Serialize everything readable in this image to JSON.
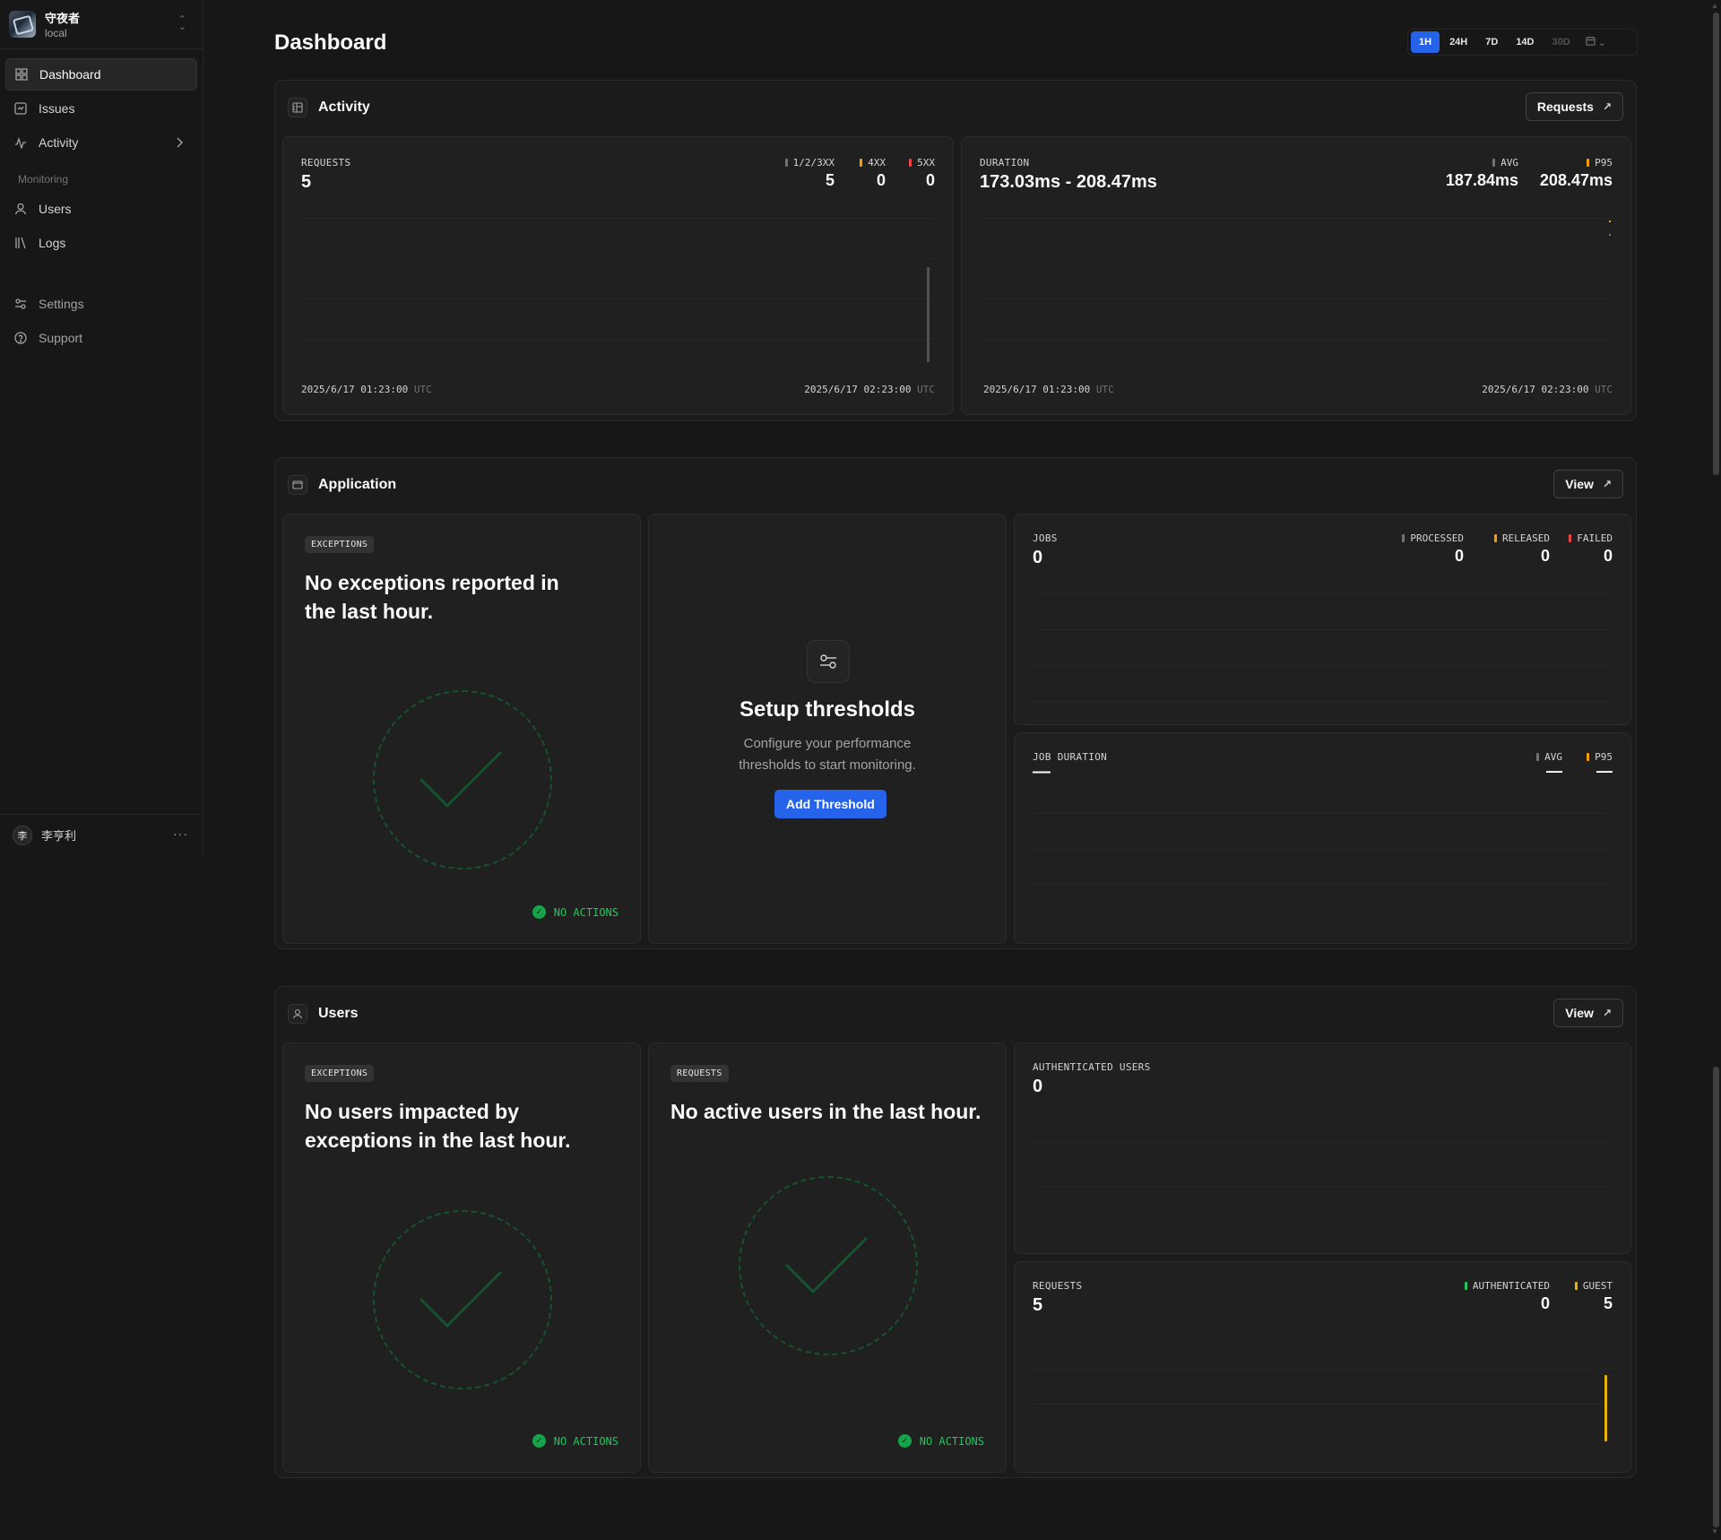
{
  "org": {
    "name": "守夜者",
    "env": "local"
  },
  "nav": {
    "items": [
      {
        "label": "Dashboard",
        "icon": "grid-icon"
      },
      {
        "label": "Issues",
        "icon": "issue-icon"
      },
      {
        "label": "Activity",
        "icon": "pulse-icon"
      }
    ],
    "monitoring_label": "Monitoring",
    "monitoring_items": [
      {
        "label": "Users",
        "icon": "user-icon"
      },
      {
        "label": "Logs",
        "icon": "logs-icon"
      }
    ],
    "footer_items": [
      {
        "label": "Settings",
        "icon": "sliders-icon"
      },
      {
        "label": "Support",
        "icon": "help-icon"
      }
    ]
  },
  "user": {
    "initial": "李",
    "name": "李亨利"
  },
  "page": {
    "title": "Dashboard"
  },
  "range": {
    "options": [
      "1H",
      "24H",
      "7D",
      "14D",
      "30D"
    ],
    "selected": "1H"
  },
  "activity": {
    "title": "Activity",
    "link": "Requests",
    "requests": {
      "label": "REQUESTS",
      "value": "5",
      "legend": [
        {
          "label": "1/2/3XX",
          "value": "5",
          "color": "#737373"
        },
        {
          "label": "4XX",
          "value": "0",
          "color": "#f59e0b"
        },
        {
          "label": "5XX",
          "value": "0",
          "color": "#ef4444"
        }
      ],
      "start_ts": "2025/6/17 01:23:00",
      "end_ts": "2025/6/17 02:23:00",
      "tz": "UTC"
    },
    "duration": {
      "label": "DURATION",
      "value": "173.03ms - 208.47ms",
      "legend": [
        {
          "label": "AVG",
          "value": "187.84ms",
          "color": "#737373"
        },
        {
          "label": "P95",
          "value": "208.47ms",
          "color": "#f59e0b"
        }
      ],
      "start_ts": "2025/6/17 01:23:00",
      "end_ts": "2025/6/17 02:23:00",
      "tz": "UTC"
    }
  },
  "application": {
    "title": "Application",
    "link": "View",
    "exceptions": {
      "pill": "EXCEPTIONS",
      "message": "No exceptions reported in the last hour.",
      "status": "NO ACTIONS"
    },
    "thresholds": {
      "title": "Setup thresholds",
      "description": "Configure your performance thresholds to start monitoring.",
      "button": "Add Threshold"
    },
    "jobs": {
      "label": "JOBS",
      "value": "0",
      "legend": [
        {
          "label": "PROCESSED",
          "value": "0",
          "color": "#737373"
        },
        {
          "label": "RELEASED",
          "value": "0",
          "color": "#f59e0b"
        },
        {
          "label": "FAILED",
          "value": "0",
          "color": "#ef4444"
        }
      ]
    },
    "job_duration": {
      "label": "JOB DURATION",
      "value": "—",
      "legend": [
        {
          "label": "AVG",
          "value": "—",
          "color": "#737373"
        },
        {
          "label": "P95",
          "value": "—",
          "color": "#f59e0b"
        }
      ]
    }
  },
  "users": {
    "title": "Users",
    "link": "View",
    "exceptions": {
      "pill": "EXCEPTIONS",
      "message": "No users impacted by exceptions in the last hour.",
      "status": "NO ACTIONS"
    },
    "requests_empty": {
      "pill": "REQUESTS",
      "message": "No active users in the last hour.",
      "status": "NO ACTIONS"
    },
    "authenticated": {
      "label": "AUTHENTICATED USERS",
      "value": "0"
    },
    "requests": {
      "label": "REQUESTS",
      "value": "5",
      "legend": [
        {
          "label": "AUTHENTICATED",
          "value": "0",
          "color": "#22c55e"
        },
        {
          "label": "GUEST",
          "value": "5",
          "color": "#eab308"
        }
      ]
    }
  }
}
